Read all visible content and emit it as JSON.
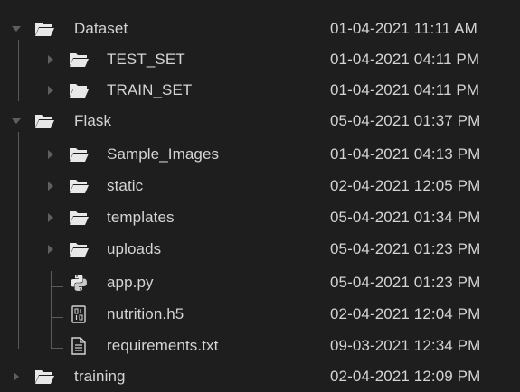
{
  "tree": {
    "dataset": {
      "name": "Dataset",
      "date": "01-04-2021 11:11 AM",
      "icon": "folder-open-icon",
      "expanded": true
    },
    "test_set": {
      "name": "TEST_SET",
      "date": "01-04-2021 04:11 PM",
      "icon": "folder-open-icon",
      "expanded": false
    },
    "train_set": {
      "name": "TRAIN_SET",
      "date": "01-04-2021 04:11 PM",
      "icon": "folder-open-icon",
      "expanded": false
    },
    "flask": {
      "name": "Flask",
      "date": "05-04-2021 01:37 PM",
      "icon": "folder-open-icon",
      "expanded": true
    },
    "sample_images": {
      "name": "Sample_Images",
      "date": "01-04-2021 04:13 PM",
      "icon": "folder-open-icon",
      "expanded": false
    },
    "static": {
      "name": "static",
      "date": "02-04-2021 12:05 PM",
      "icon": "folder-open-icon",
      "expanded": false
    },
    "templates": {
      "name": "templates",
      "date": "05-04-2021 01:34 PM",
      "icon": "folder-open-icon",
      "expanded": false
    },
    "uploads": {
      "name": "uploads",
      "date": "05-04-2021 01:23 PM",
      "icon": "folder-open-icon",
      "expanded": false
    },
    "app_py": {
      "name": "app.py",
      "date": "05-04-2021 01:23 PM",
      "icon": "python-file-icon"
    },
    "nutrition_h5": {
      "name": "nutrition.h5",
      "date": "02-04-2021 12:04 PM",
      "icon": "binary-file-icon"
    },
    "requirements_txt": {
      "name": "requirements.txt",
      "date": "09-03-2021 12:34 PM",
      "icon": "text-file-icon"
    },
    "training": {
      "name": "training",
      "date": "02-04-2021 12:09 PM",
      "icon": "folder-open-icon",
      "expanded": false
    }
  },
  "colors": {
    "background": "#1e1e1e",
    "text": "#d4d4d4",
    "folder": "#e8e8e8",
    "arrow": "#5f5f5f",
    "guide": "#5a5a5a"
  }
}
